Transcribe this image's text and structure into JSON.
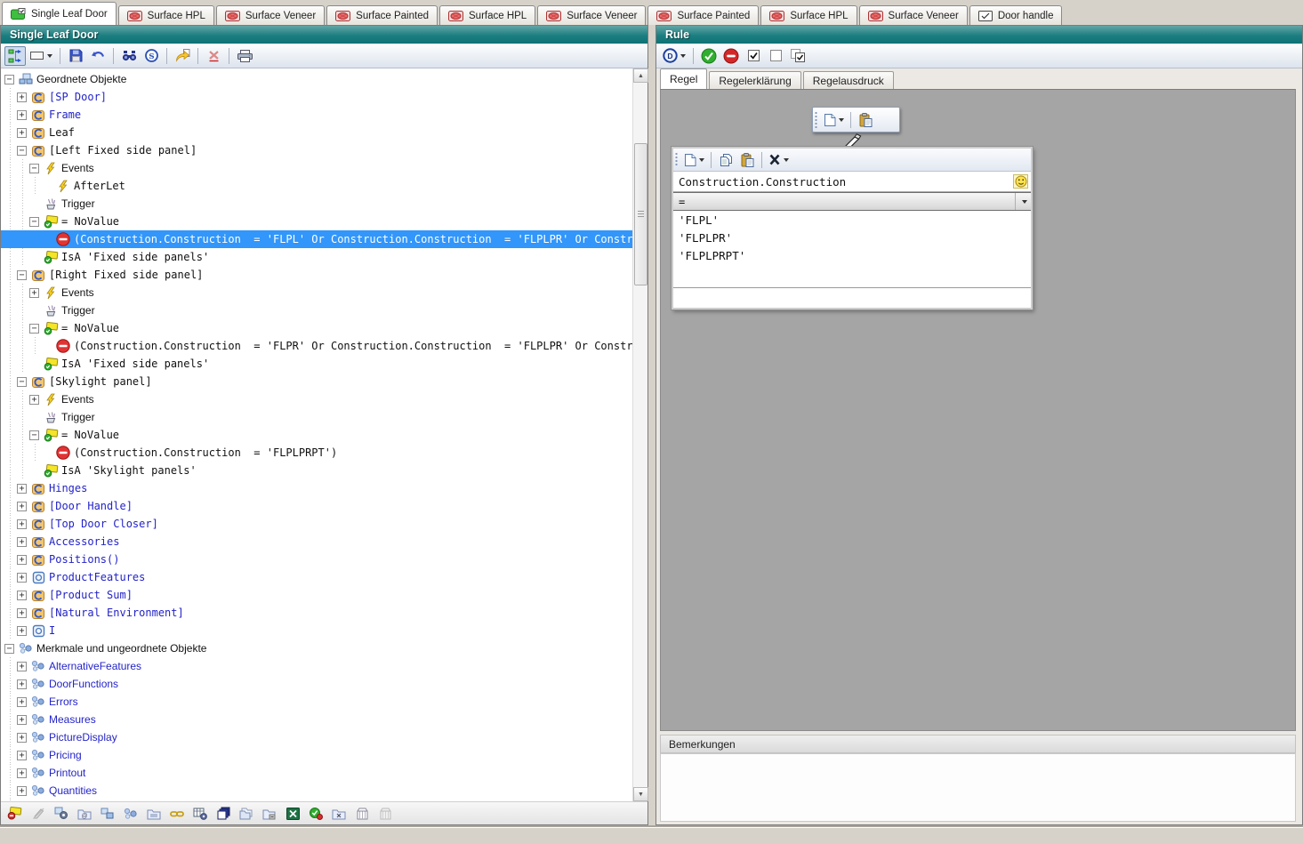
{
  "tabs": [
    {
      "label": "Single Leaf Door",
      "icon": "doc-green",
      "active": true
    },
    {
      "label": "Surface HPL",
      "icon": "doc-red",
      "active": false
    },
    {
      "label": "Surface Veneer",
      "icon": "doc-red",
      "active": false
    },
    {
      "label": "Surface Painted",
      "icon": "doc-red",
      "active": false
    },
    {
      "label": "Surface HPL",
      "icon": "doc-red",
      "active": false
    },
    {
      "label": "Surface Veneer",
      "icon": "doc-red",
      "active": false
    },
    {
      "label": "Surface Painted",
      "icon": "doc-red",
      "active": false
    },
    {
      "label": "Surface HPL",
      "icon": "doc-red",
      "active": false
    },
    {
      "label": "Surface Veneer",
      "icon": "doc-red",
      "active": false
    },
    {
      "label": "Door handle",
      "icon": "doc-check",
      "active": false
    }
  ],
  "left_panel": {
    "title": "Single Leaf Door",
    "toolbar": [
      {
        "icon": "tree-view",
        "active": true
      },
      {
        "icon": "shape-rect",
        "caret": true
      },
      {
        "sep": true
      },
      {
        "icon": "save"
      },
      {
        "icon": "undo"
      },
      {
        "sep": true
      },
      {
        "icon": "find"
      },
      {
        "icon": "letter-s"
      },
      {
        "sep": true
      },
      {
        "icon": "goto-page"
      },
      {
        "sep": true
      },
      {
        "icon": "delete-x"
      },
      {
        "sep": true
      },
      {
        "icon": "print"
      }
    ],
    "tree": [
      {
        "depth": 0,
        "expander": "minus",
        "icon": "objects-root",
        "text": "Geordnete Objekte",
        "font": "sans",
        "color": "black"
      },
      {
        "depth": 1,
        "expander": "plus",
        "icon": "cube",
        "text": "[SP Door]",
        "font": "mono",
        "color": "blue"
      },
      {
        "depth": 1,
        "expander": "plus",
        "icon": "cube",
        "text": "Frame",
        "font": "mono",
        "color": "blue"
      },
      {
        "depth": 1,
        "expander": "plus",
        "icon": "cube",
        "text": "Leaf",
        "font": "mono",
        "color": "black"
      },
      {
        "depth": 1,
        "expander": "minus",
        "icon": "cube",
        "text": "[Left Fixed side panel]",
        "font": "mono",
        "color": "black"
      },
      {
        "depth": 2,
        "expander": "minus",
        "icon": "lightning",
        "text": "Events",
        "font": "sans",
        "color": "black"
      },
      {
        "depth": 3,
        "expander": null,
        "icon": "lightning",
        "text": "AfterLet",
        "font": "mono",
        "color": "black"
      },
      {
        "depth": 2,
        "expander": null,
        "icon": "trigger",
        "text": "Trigger",
        "font": "sans",
        "color": "black"
      },
      {
        "depth": 2,
        "expander": "minus",
        "icon": "tag-check",
        "text": "= NoValue",
        "font": "mono",
        "color": "black"
      },
      {
        "depth": 3,
        "expander": null,
        "icon": "no-entry",
        "text": "(Construction.Construction  = 'FLPL' Or Construction.Construction  = 'FLPLPR' Or Constructi",
        "font": "mono",
        "color": "white",
        "selected": true
      },
      {
        "depth": 2,
        "expander": null,
        "icon": "tag-check",
        "text": "IsA 'Fixed side panels'",
        "font": "mono",
        "color": "black"
      },
      {
        "depth": 1,
        "expander": "minus",
        "icon": "cube",
        "text": "[Right Fixed side panel]",
        "font": "mono",
        "color": "black"
      },
      {
        "depth": 2,
        "expander": "plus",
        "icon": "lightning",
        "text": "Events",
        "font": "sans",
        "color": "black"
      },
      {
        "depth": 2,
        "expander": null,
        "icon": "trigger",
        "text": "Trigger",
        "font": "sans",
        "color": "black"
      },
      {
        "depth": 2,
        "expander": "minus",
        "icon": "tag-check",
        "text": "= NoValue",
        "font": "mono",
        "color": "black"
      },
      {
        "depth": 3,
        "expander": null,
        "icon": "no-entry",
        "text": "(Construction.Construction  = 'FLPR' Or Construction.Construction  = 'FLPLPR' Or Constructi",
        "font": "mono",
        "color": "black"
      },
      {
        "depth": 2,
        "expander": null,
        "icon": "tag-check",
        "text": "IsA 'Fixed side panels'",
        "font": "mono",
        "color": "black"
      },
      {
        "depth": 1,
        "expander": "minus",
        "icon": "cube",
        "text": "[Skylight panel]",
        "font": "mono",
        "color": "black"
      },
      {
        "depth": 2,
        "expander": "plus",
        "icon": "lightning",
        "text": "Events",
        "font": "sans",
        "color": "black"
      },
      {
        "depth": 2,
        "expander": null,
        "icon": "trigger",
        "text": "Trigger",
        "font": "sans",
        "color": "black"
      },
      {
        "depth": 2,
        "expander": "minus",
        "icon": "tag-check",
        "text": "= NoValue",
        "font": "mono",
        "color": "black"
      },
      {
        "depth": 3,
        "expander": null,
        "icon": "no-entry",
        "text": "(Construction.Construction  = 'FLPLPRPT')",
        "font": "mono",
        "color": "black"
      },
      {
        "depth": 2,
        "expander": null,
        "icon": "tag-check",
        "text": "IsA 'Skylight panels'",
        "font": "mono",
        "color": "black"
      },
      {
        "depth": 1,
        "expander": "plus",
        "icon": "cube",
        "text": "Hinges",
        "font": "mono",
        "color": "blue"
      },
      {
        "depth": 1,
        "expander": "plus",
        "icon": "cube",
        "text": "[Door Handle]",
        "font": "mono",
        "color": "blue"
      },
      {
        "depth": 1,
        "expander": "plus",
        "icon": "cube",
        "text": "[Top Door Closer]",
        "font": "mono",
        "color": "blue"
      },
      {
        "depth": 1,
        "expander": "plus",
        "icon": "cube",
        "text": "Accessories",
        "font": "mono",
        "color": "blue"
      },
      {
        "depth": 1,
        "expander": "plus",
        "icon": "cube",
        "text": "Positions()",
        "font": "mono",
        "color": "blue"
      },
      {
        "depth": 1,
        "expander": "plus",
        "icon": "blue-square",
        "text": "ProductFeatures",
        "font": "mono",
        "color": "blue"
      },
      {
        "depth": 1,
        "expander": "plus",
        "icon": "cube",
        "text": "[Product Sum]",
        "font": "mono",
        "color": "blue"
      },
      {
        "depth": 1,
        "expander": "plus",
        "icon": "cube",
        "text": "[Natural Environment]",
        "font": "mono",
        "color": "blue"
      },
      {
        "depth": 1,
        "expander": "plus",
        "icon": "blue-square",
        "text": "I",
        "font": "mono",
        "color": "blue"
      },
      {
        "depth": 0,
        "expander": "minus",
        "icon": "molecule",
        "text": "Merkmale und ungeordnete Objekte",
        "font": "sans",
        "color": "black"
      },
      {
        "depth": 1,
        "expander": "plus",
        "icon": "molecule",
        "text": "AlternativeFeatures",
        "font": "sans",
        "color": "blue"
      },
      {
        "depth": 1,
        "expander": "plus",
        "icon": "molecule",
        "text": "DoorFunctions",
        "font": "sans",
        "color": "blue"
      },
      {
        "depth": 1,
        "expander": "plus",
        "icon": "molecule",
        "text": "Errors",
        "font": "sans",
        "color": "blue"
      },
      {
        "depth": 1,
        "expander": "plus",
        "icon": "molecule",
        "text": "Measures",
        "font": "sans",
        "color": "blue"
      },
      {
        "depth": 1,
        "expander": "plus",
        "icon": "molecule",
        "text": "PictureDisplay",
        "font": "sans",
        "color": "blue"
      },
      {
        "depth": 1,
        "expander": "plus",
        "icon": "molecule",
        "text": "Pricing",
        "font": "sans",
        "color": "blue"
      },
      {
        "depth": 1,
        "expander": "plus",
        "icon": "molecule",
        "text": "Printout",
        "font": "sans",
        "color": "blue"
      },
      {
        "depth": 1,
        "expander": "plus",
        "icon": "molecule",
        "text": "Quantities",
        "font": "sans",
        "color": "blue"
      },
      {
        "depth": 1,
        "expander": null,
        "icon": "molecule",
        "text": "",
        "font": "sans",
        "color": "blue"
      }
    ],
    "bottom_toolbar": [
      {
        "icon": "tag-remove"
      },
      {
        "icon": "edit-disabled"
      },
      {
        "icon": "object-gear"
      },
      {
        "icon": "folder-at"
      },
      {
        "icon": "object-pair"
      },
      {
        "icon": "molecule"
      },
      {
        "icon": "folder-doc"
      },
      {
        "icon": "link"
      },
      {
        "icon": "table-gear"
      },
      {
        "icon": "layers"
      },
      {
        "icon": "folder-copy"
      },
      {
        "icon": "folder-export"
      },
      {
        "icon": "excel"
      },
      {
        "icon": "check-red"
      },
      {
        "icon": "folder-x"
      },
      {
        "icon": "archive"
      },
      {
        "icon": "archive-disabled"
      }
    ]
  },
  "right_panel": {
    "title": "Rule",
    "toolbar": [
      {
        "icon": "circle-d",
        "caret": true
      },
      {
        "sep": true
      },
      {
        "icon": "check-circle"
      },
      {
        "icon": "minus-circle"
      },
      {
        "icon": "checkbox-checked"
      },
      {
        "icon": "checkbox-unchecked"
      },
      {
        "icon": "checkbox-double"
      }
    ],
    "tabs": [
      {
        "label": "Regel",
        "active": true
      },
      {
        "label": "Regelerklärung",
        "active": false
      },
      {
        "label": "Regelausdruck",
        "active": false
      }
    ],
    "float_toolbar": [
      {
        "icon": "new-page",
        "caret": true
      },
      {
        "sep": true
      },
      {
        "icon": "paste"
      }
    ],
    "editor": {
      "toolbar": [
        {
          "icon": "new-page",
          "caret": true
        },
        {
          "sep": true
        },
        {
          "icon": "copy"
        },
        {
          "icon": "paste"
        },
        {
          "sep": true
        },
        {
          "icon": "delete-bold",
          "caret": true
        }
      ],
      "field": "Construction.Construction",
      "operator": "=",
      "values": [
        "'FLPL'",
        "'FLPLPR'",
        "'FLPLPRPT'"
      ]
    },
    "notes_label": "Bemerkungen"
  },
  "colors": {
    "header_teal": "#15797b",
    "selection_blue": "#3296fa",
    "canvas_gray": "#a5a5a5",
    "tree_item_blue": "#2323c8"
  }
}
